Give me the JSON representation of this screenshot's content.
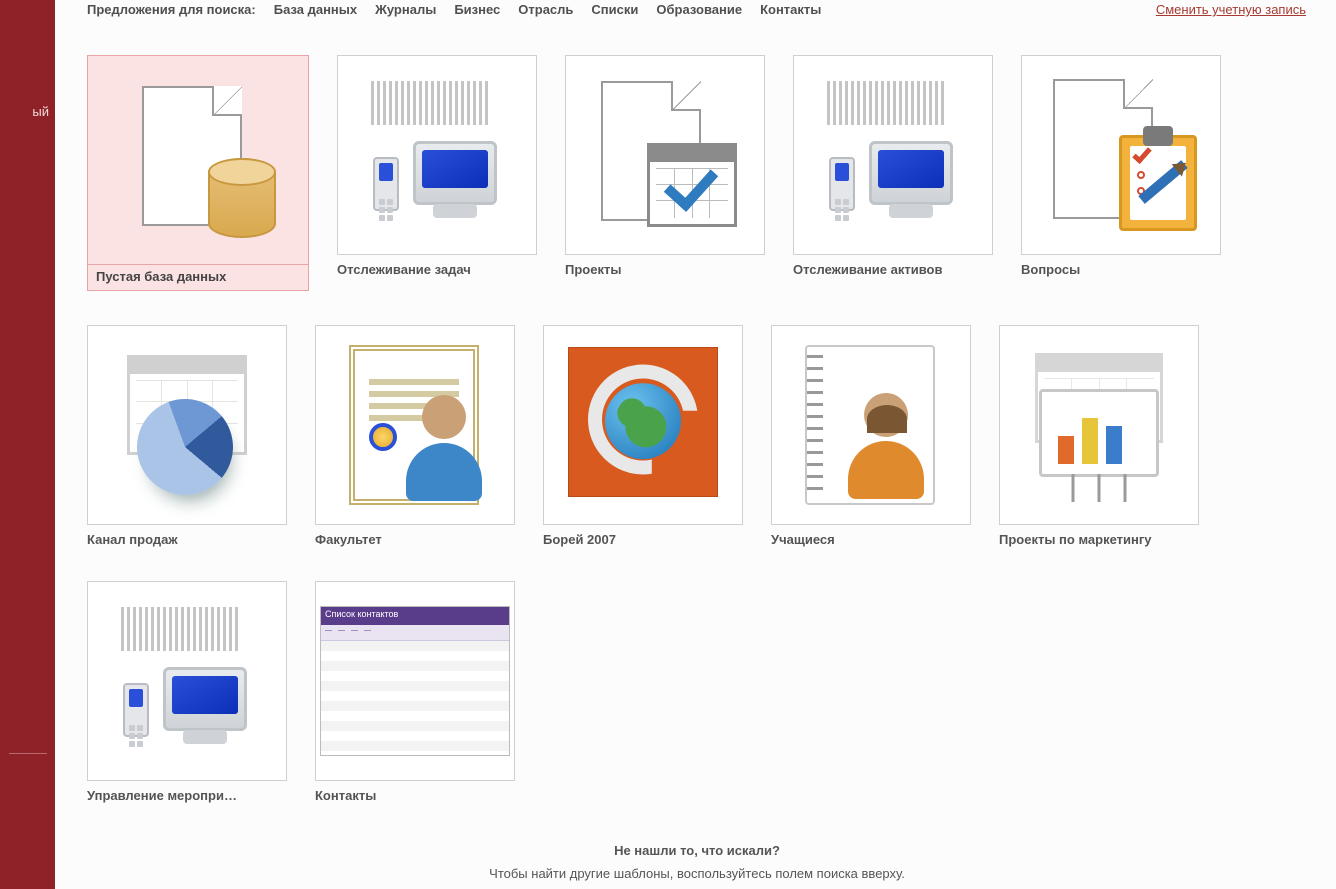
{
  "sidebar": {
    "label": "ый"
  },
  "search": {
    "prompt": "Предложения для поиска:",
    "links": [
      "База данных",
      "Журналы",
      "Бизнес",
      "Отрасль",
      "Списки",
      "Образование",
      "Контакты"
    ]
  },
  "account_link": "Сменить учетную запись",
  "templates": [
    {
      "label": "Пустая база данных",
      "icon": "blank-db",
      "selected": true
    },
    {
      "label": "Отслеживание задач",
      "icon": "tasks"
    },
    {
      "label": "Проекты",
      "icon": "projects"
    },
    {
      "label": "Отслеживание активов",
      "icon": "assets"
    },
    {
      "label": "Вопросы",
      "icon": "issues"
    },
    {
      "label": "Канал продаж",
      "icon": "sales"
    },
    {
      "label": "Факультет",
      "icon": "faculty"
    },
    {
      "label": "Борей 2007",
      "icon": "northwind"
    },
    {
      "label": "Учащиеся",
      "icon": "students"
    },
    {
      "label": "Проекты по маркетингу",
      "icon": "marketing"
    },
    {
      "label": "Управление меропри…",
      "icon": "events"
    },
    {
      "label": "Контакты",
      "icon": "contacts-app"
    }
  ],
  "footer": {
    "question": "Не нашли то, что искали?",
    "hint": "Чтобы найти другие шаблоны, воспользуйтесь полем поиска вверху."
  },
  "contacts_widget": {
    "title": "Список контактов"
  }
}
